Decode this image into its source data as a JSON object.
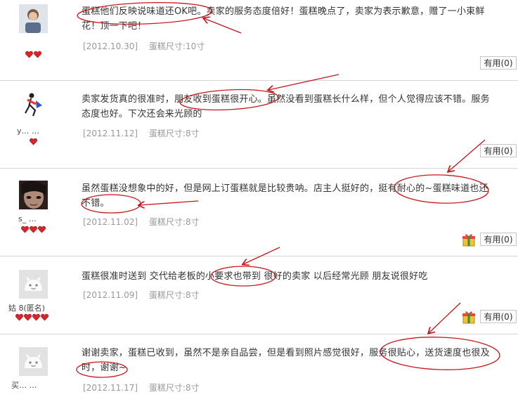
{
  "reviews": [
    {
      "user": "",
      "avatar_icon": "user-photo",
      "rating_hearts": 2,
      "text": "蛋糕他们反映说味道还OK吧。卖家的服务态度倍好！蛋糕晚点了，卖家为表示歉意，赠了一小束鲜花！顶一下吧！",
      "date": "[2012.10.30]",
      "spec": "蛋糕尺寸:10寸",
      "useful_label": "有用(0)",
      "has_gift": false
    },
    {
      "user": "y… …",
      "avatar_icon": "running-figure",
      "rating_hearts": 1,
      "text": "卖家发货真的很准时，朋友收到蛋糕很开心。虽然没看到蛋糕长什么样，但个人觉得应该不错。服务态度也好。下次还会来光顾的",
      "date": "[2012.11.12]",
      "spec": "蛋糕尺寸:8寸",
      "useful_label": "有用(0)",
      "has_gift": false
    },
    {
      "user": "s_ …",
      "avatar_icon": "face-photo",
      "rating_hearts": 3,
      "text": "虽然蛋糕没想象中的好，但是网上订蛋糕就是比较贵呐。店主人挺好的，挺有耐心的~蛋糕味道也还不错。",
      "date": "[2012.11.02]",
      "spec": "蛋糕尺寸:8寸",
      "useful_label": "有用(0)",
      "has_gift": true
    },
    {
      "user": "姑     8(匿名)",
      "avatar_icon": "default-avatar",
      "rating_hearts": 4,
      "text": "蛋糕很准时送到 交代给老板的小要求也带到 很好的卖家 以后经常光顾 朋友说很好吃",
      "date": "[2012.11.09]",
      "spec": "蛋糕尺寸:8寸",
      "useful_label": "有用(0)",
      "has_gift": true
    },
    {
      "user": "买…  …",
      "avatar_icon": "default-avatar",
      "rating_hearts": 0,
      "text": "谢谢卖家，蛋糕已收到，虽然不是亲自品尝，但是看到照片感觉很好，服务很贴心，送货速度也很及时，谢谢~",
      "date": "[2012.11.17]",
      "spec": "蛋糕尺寸:8寸",
      "useful_label": "",
      "has_gift": false
    }
  ],
  "colors": {
    "annotation_red": "#c8161d",
    "heart_red": "#d9252a",
    "meta_gray": "#999999",
    "divider": "#d6d6d6"
  }
}
